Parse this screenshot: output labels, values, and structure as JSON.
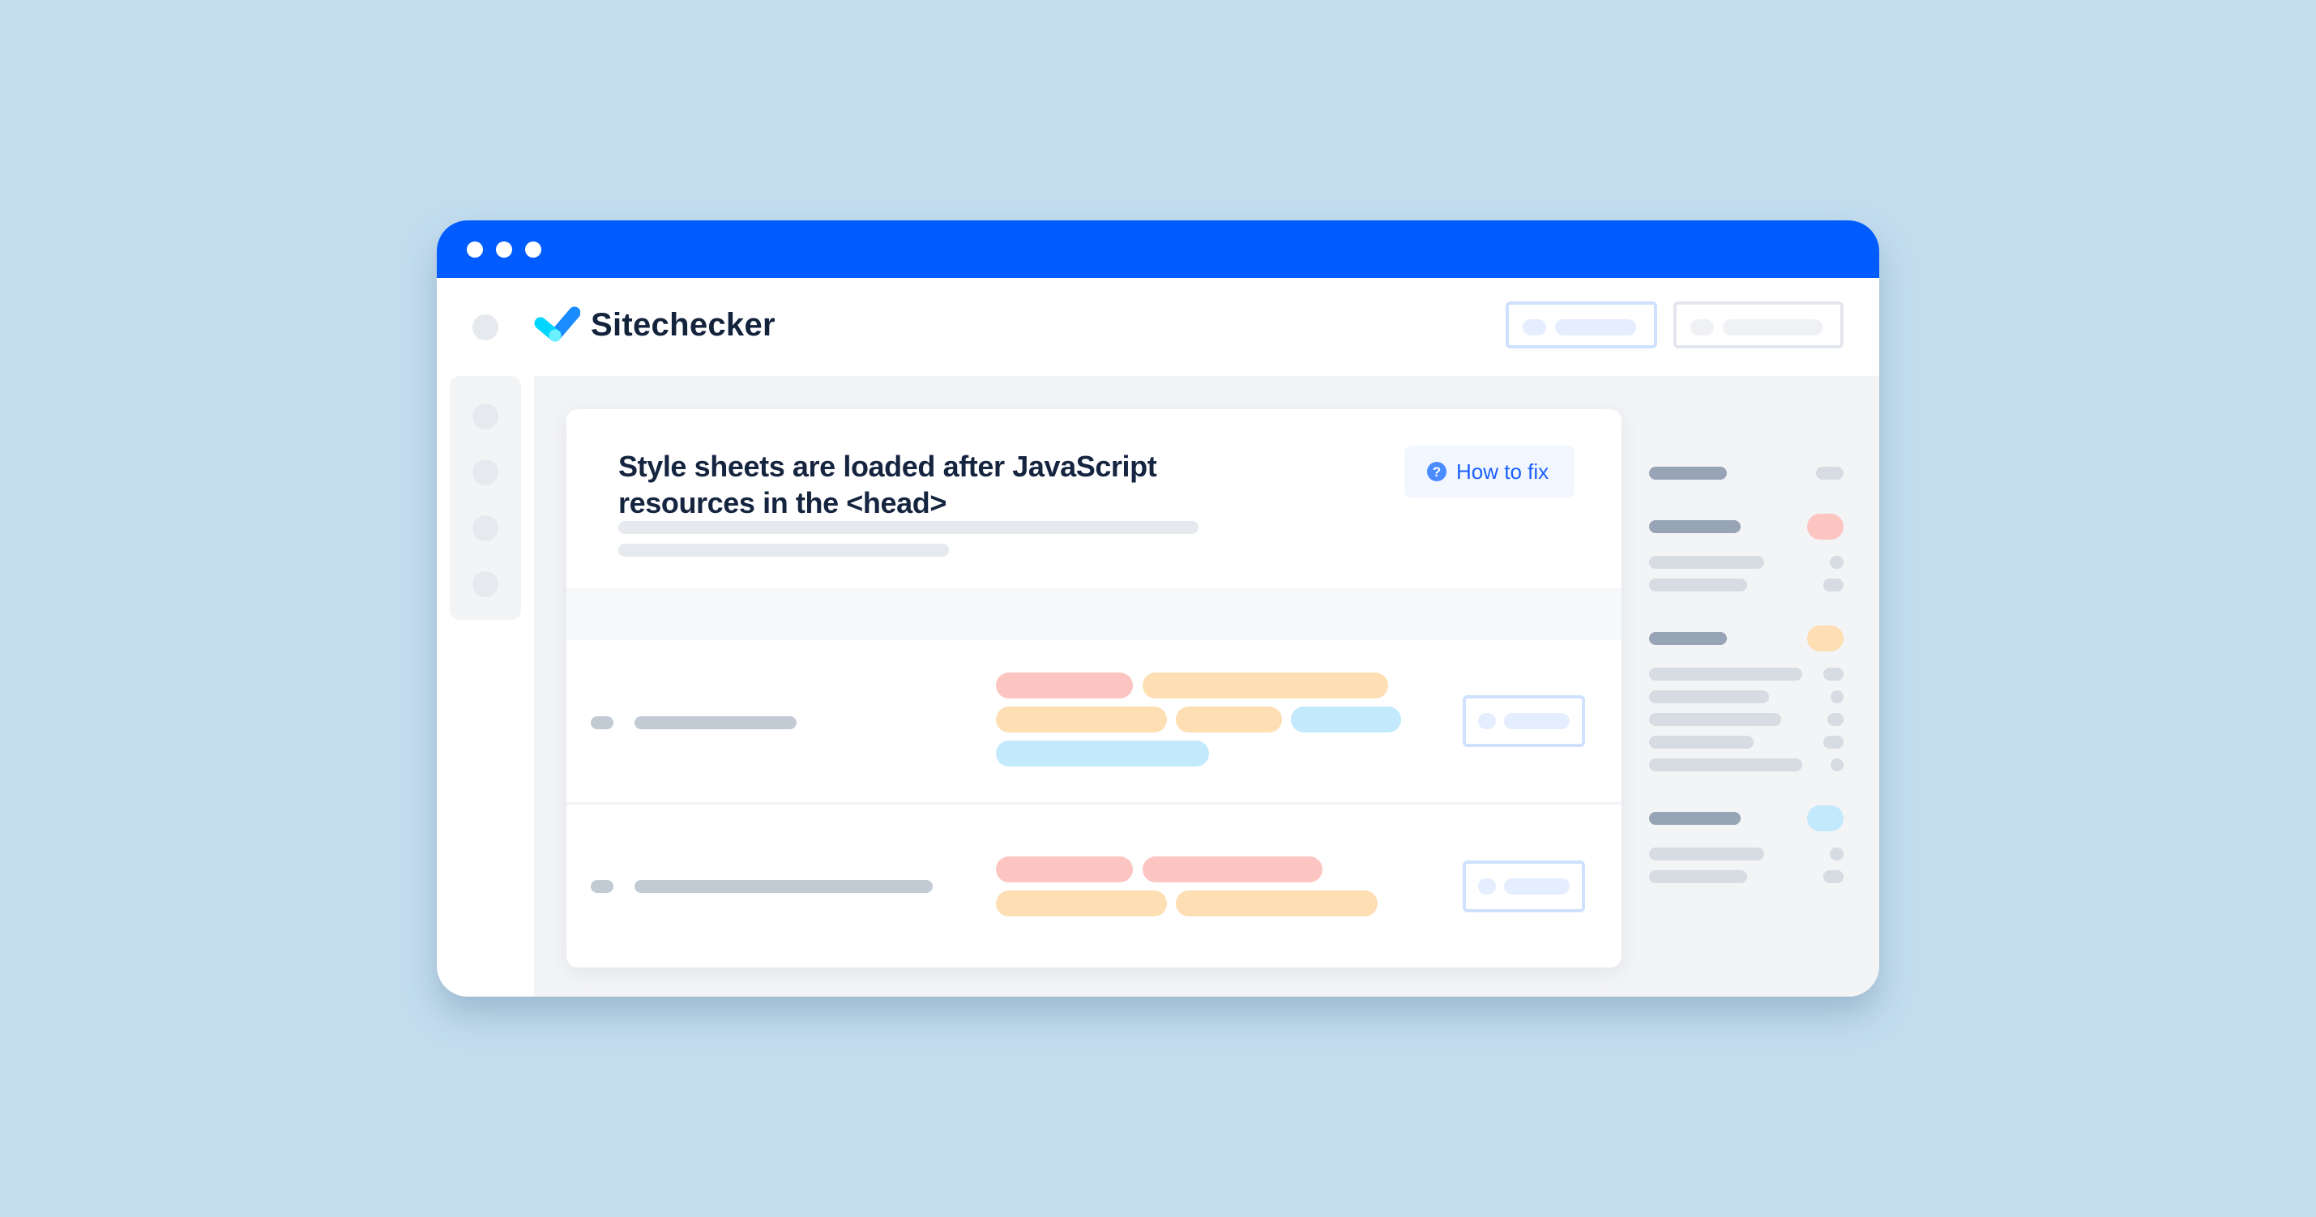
{
  "app": {
    "brand": "Sitechecker",
    "window_controls": [
      "dot",
      "dot",
      "dot"
    ],
    "colors": {
      "background": "#c3ddef",
      "titlebar": "#005cff",
      "text_dark": "#15243f",
      "link_blue": "#1a5fff",
      "tag_red": "#fcc5c2",
      "tag_orange": "#fedeb3",
      "tag_blue": "#c2e9fc"
    }
  },
  "header": {
    "logo_icon": "checkmark-logo-icon",
    "buttons": [
      {
        "name": "primary-placeholder-button",
        "style": "primary"
      },
      {
        "name": "secondary-placeholder-button",
        "style": "secondary"
      }
    ]
  },
  "left_nav": {
    "items": [
      "nav-item",
      "nav-item",
      "nav-item",
      "nav-item"
    ]
  },
  "issue": {
    "title_line1": "Style sheets are loaded after JavaScript",
    "title_line2": "resources in the <head>",
    "how_to_fix_label": "How to fix",
    "how_to_fix_icon": "?"
  },
  "rows": [
    {
      "tags": [
        [
          "red",
          "orange"
        ],
        [
          "orange",
          "orange",
          "blue"
        ],
        [
          "blue"
        ]
      ]
    },
    {
      "tags": [
        [
          "red",
          "red"
        ],
        [
          "orange",
          "orange"
        ]
      ]
    }
  ],
  "right_panel": {
    "sections": [
      {
        "badge": null,
        "sub_rows": 0
      },
      {
        "badge": "red",
        "sub_rows": 2
      },
      {
        "badge": "orange",
        "sub_rows": 5
      },
      {
        "badge": "blue",
        "sub_rows": 2
      }
    ]
  }
}
